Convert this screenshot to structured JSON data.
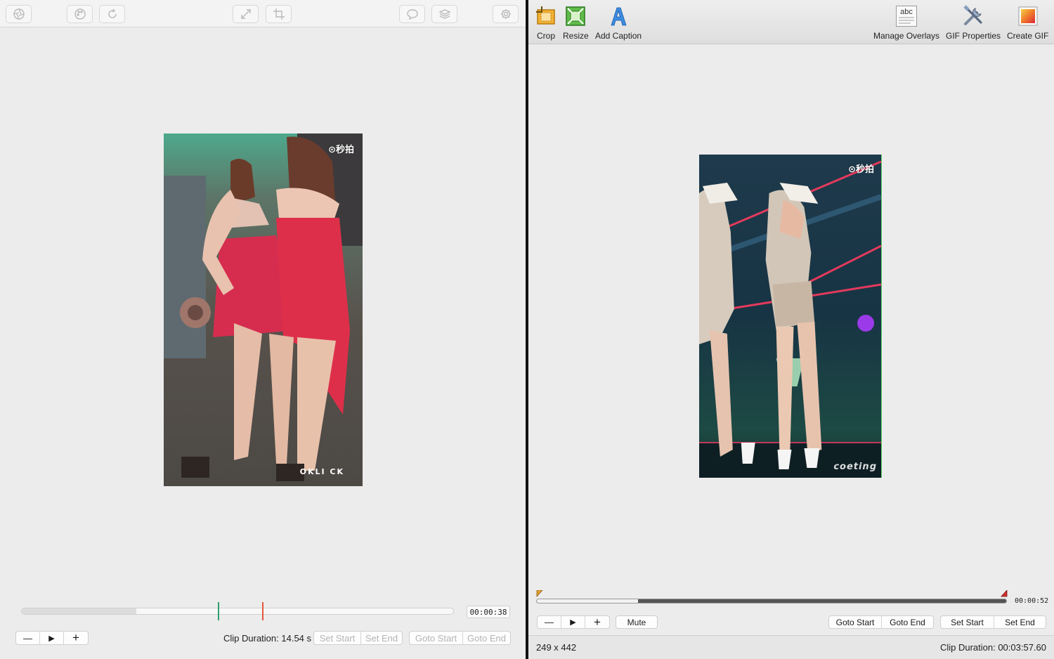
{
  "left_window": {
    "toolbar_icons": [
      "aperture-icon",
      "palette-icon",
      "rotate-icon",
      "resize-arrow-icon",
      "crop-icon",
      "speech-bubble-icon",
      "layers-icon",
      "gear-icon"
    ],
    "preview": {
      "watermark_top": "⊙秒拍",
      "watermark_bottom": "OKLI CK"
    },
    "timeline": {
      "played_fraction": 0.265,
      "start_marker_fraction": 0.456,
      "end_marker_fraction": 0.558,
      "start_marker_color": "#2e9e6e",
      "end_marker_color": "#e0573c",
      "timecode": "00:00:38"
    },
    "zoom_out_label": "—",
    "play_label": "▶",
    "zoom_in_label": "+",
    "clip_duration": "Clip Duration: 14.54 s",
    "set_start": "Set Start",
    "set_end": "Set End",
    "goto_start": "Goto Start",
    "goto_end": "Goto End"
  },
  "right_window": {
    "toolbar": {
      "crop": "Crop",
      "resize": "Resize",
      "add_caption": "Add Caption",
      "manage_overlays": "Manage Overlays",
      "manage_overlays_icon_text": "abc",
      "gif_properties": "GIF Properties",
      "create_gif": "Create GIF"
    },
    "preview": {
      "watermark_top": "⊙秒拍",
      "watermark_bottom": "coeting"
    },
    "timeline": {
      "played_fraction": 0.215,
      "timecode": "00:00:52",
      "start_marker_color": "#e0a030",
      "end_marker_color": "#d23030"
    },
    "zoom_out_label": "—",
    "play_label": "▶",
    "zoom_in_label": "+",
    "mute": "Mute",
    "goto_start": "Goto Start",
    "goto_end": "Goto End",
    "set_start": "Set Start",
    "set_end": "Set End",
    "dimensions": "249 x 442",
    "clip_duration": "Clip Duration: 00:03:57.60"
  }
}
